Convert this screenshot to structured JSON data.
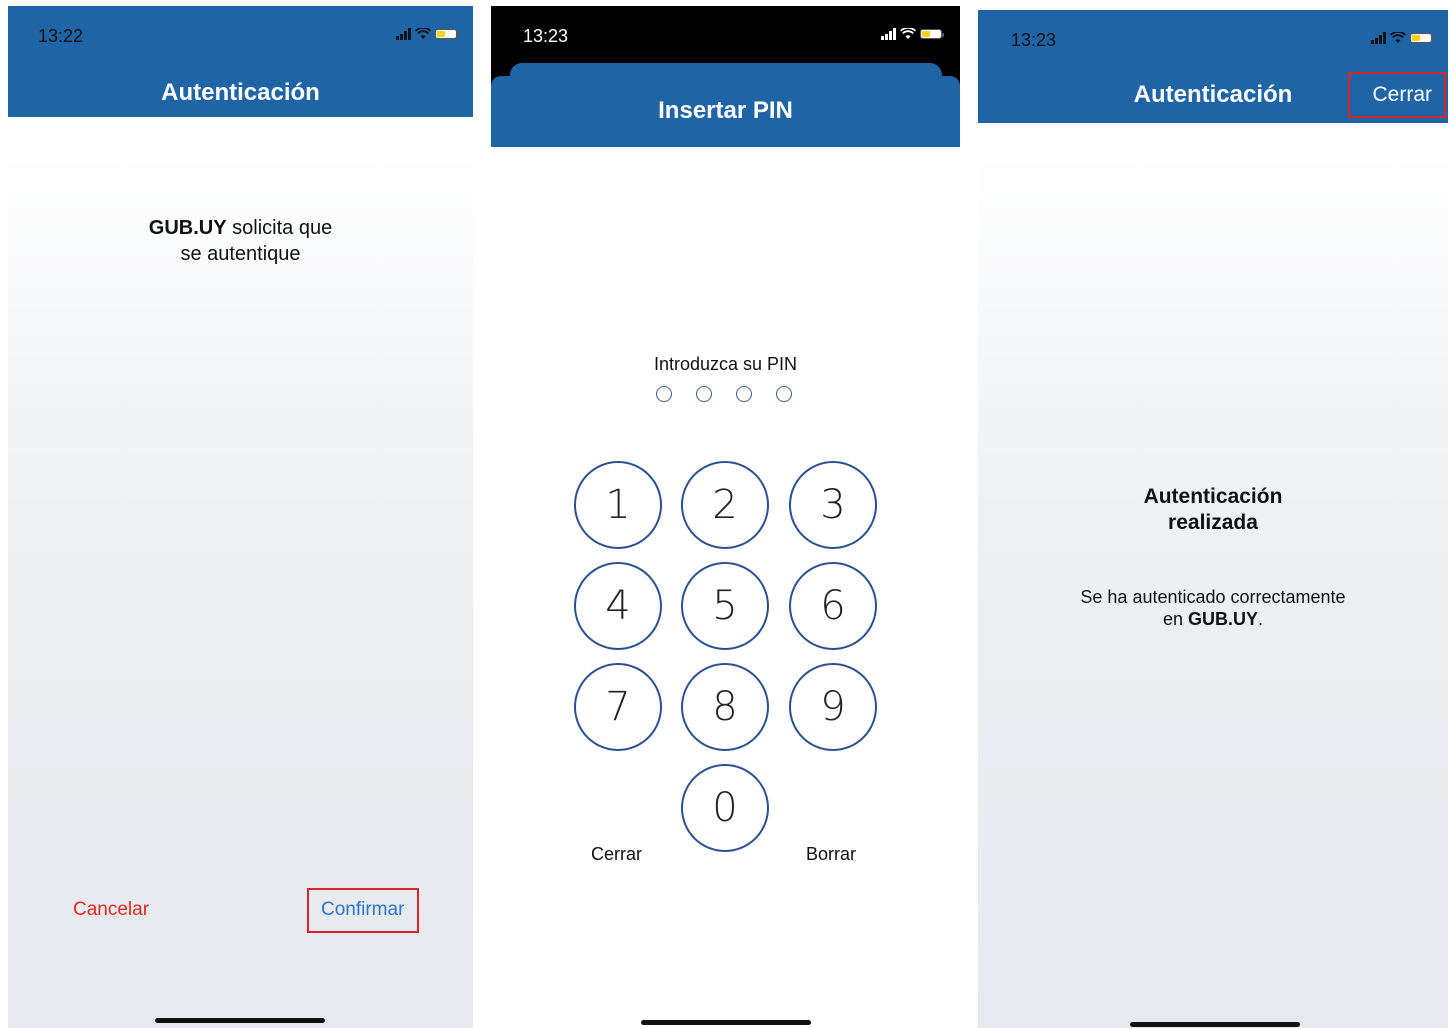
{
  "screens": [
    {
      "status_time": "13:22",
      "nav_title": "Autenticación",
      "request_app": "GUB.UY",
      "request_text_line1": " solicita que",
      "request_text_line2": "se autentique",
      "cancel_label": "Cancelar",
      "confirm_label": "Confirmar"
    },
    {
      "status_time": "13:23",
      "nav_title": "Insertar PIN",
      "pin_prompt": "Introduzca su PIN",
      "keys": [
        "1",
        "2",
        "3",
        "4",
        "5",
        "6",
        "7",
        "8",
        "9",
        "0"
      ],
      "close_label": "Cerrar",
      "delete_label": "Borrar"
    },
    {
      "status_time": "13:23",
      "nav_title": "Autenticación",
      "close_label": "Cerrar",
      "success_title_line1": "Autenticación",
      "success_title_line2": "realizada",
      "success_msg_line1": "Se ha autenticado correctamente",
      "success_msg_line2_prefix": "en ",
      "success_msg_app": "GUB.UY",
      "success_msg_suffix": "."
    }
  ],
  "colors": {
    "navbar": "#1f64a4",
    "cancel": "#e8261f",
    "confirm": "#2c73d2",
    "highlight_box": "#d9232d",
    "key_ring": "#2c4f8f"
  },
  "icons": [
    "signal-icon",
    "wifi-icon",
    "battery-icon"
  ]
}
